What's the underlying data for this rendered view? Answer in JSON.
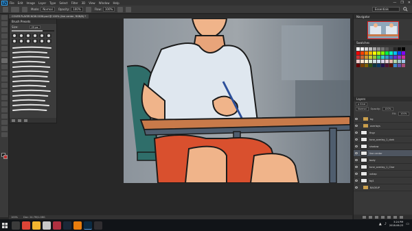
{
  "app": {
    "logo": "Ps",
    "menu": [
      "File",
      "Edit",
      "Image",
      "Layer",
      "Type",
      "Select",
      "Filter",
      "3D",
      "View",
      "Window",
      "Help"
    ],
    "window_controls": [
      "—",
      "❐",
      "✕"
    ]
  },
  "options_bar": {
    "mode_label": "Mode:",
    "mode_value": "Normal",
    "opacity_label": "Opacity:",
    "opacity_value": "100%",
    "flow_label": "Flow:",
    "flow_value": "100%",
    "workspace": "Essentials"
  },
  "document": {
    "tab_title": "COVER PLAYER NOW 0036.psd @ 100% (line center, RGB/8) *",
    "zoom": "100%",
    "doc_info": "Doc: 24.7M/1.08G"
  },
  "brush_presets": {
    "title": "Brush Presets",
    "size_label": "Size:",
    "size_value": "25 px",
    "hardness": 0.72,
    "tip_count": 12,
    "strokes": [
      0.95,
      0.85,
      0.9,
      0.8,
      0.92,
      0.88,
      0.86,
      0.9,
      0.82,
      0.93,
      0.87,
      0.8,
      0.9,
      0.84
    ]
  },
  "panels": {
    "navigator": "Navigator",
    "swatches": "Swatches",
    "layers": "Layers"
  },
  "layers": {
    "kind_label": "ρ Kind",
    "blend_mode": "Normal",
    "opacity_label": "Opacity:",
    "opacity_value": "100%",
    "fill_label": "Fill:",
    "fill_value": "100%",
    "items": [
      {
        "name": "bg",
        "type": "group",
        "selected": false
      },
      {
        "name": "overlays",
        "type": "group",
        "selected": false
      },
      {
        "name": "fingr",
        "type": "layer",
        "selected": false
      },
      {
        "name": "tone_overlay_1_dark",
        "type": "layer",
        "selected": false
      },
      {
        "name": "shadow",
        "type": "layer",
        "selected": false
      },
      {
        "name": "line center",
        "type": "layer",
        "selected": true
      },
      {
        "name": "body",
        "type": "layer",
        "selected": false
      },
      {
        "name": "tone_overlay_1_Char",
        "type": "layer",
        "selected": false
      },
      {
        "name": "ushap",
        "type": "layer",
        "selected": false
      },
      {
        "name": "bg1",
        "type": "layer",
        "selected": false
      },
      {
        "name": "BACKUP",
        "type": "group",
        "selected": false
      }
    ]
  },
  "swatch_colors": [
    "#ffffff",
    "#f2f2f2",
    "#d9d9d9",
    "#bfbfbf",
    "#a6a6a6",
    "#8c8c8c",
    "#737373",
    "#595959",
    "#404040",
    "#262626",
    "#0d0d0d",
    "#000000",
    "#ff0000",
    "#ff4000",
    "#ff8000",
    "#ffbf00",
    "#ffff00",
    "#bfff00",
    "#80ff00",
    "#00ff40",
    "#00ffbf",
    "#00bfff",
    "#0040ff",
    "#8000ff",
    "#cc3333",
    "#cc6633",
    "#cc9933",
    "#cccc33",
    "#99cc33",
    "#33cc66",
    "#33cccc",
    "#3399cc",
    "#3366cc",
    "#6633cc",
    "#9933cc",
    "#cc3399",
    "#f4cccc",
    "#fce5cd",
    "#fff2cc",
    "#d9ead3",
    "#d0e0e3",
    "#cfe2f3",
    "#d9d2e9",
    "#ead1dc",
    "#e6b8af",
    "#b6d7a8",
    "#a2c4c9",
    "#9fc5e8",
    "#660000",
    "#783f04",
    "#7f6000",
    "#274e13",
    "#0c343d",
    "#073763",
    "#20124d",
    "#4c1130",
    "#5b0f00",
    "#3d85c6",
    "#674ea7",
    "#a64d79"
  ],
  "taskbar": {
    "apps": [
      {
        "name": "task-view",
        "color": "#3b3b3b"
      },
      {
        "name": "chrome",
        "color": "#db4437"
      },
      {
        "name": "file-explorer",
        "color": "#f2b530"
      },
      {
        "name": "media-player",
        "color": "#c8c8c8"
      },
      {
        "name": "game-app",
        "color": "#b03040"
      },
      {
        "name": "steam",
        "color": "#1b2838"
      },
      {
        "name": "blender",
        "color": "#e87d0d"
      },
      {
        "name": "photoshop",
        "color": "#0c2b43"
      },
      {
        "name": "obs",
        "color": "#302e31"
      }
    ],
    "time": "3:24 PM",
    "date": "2018-06-23"
  }
}
